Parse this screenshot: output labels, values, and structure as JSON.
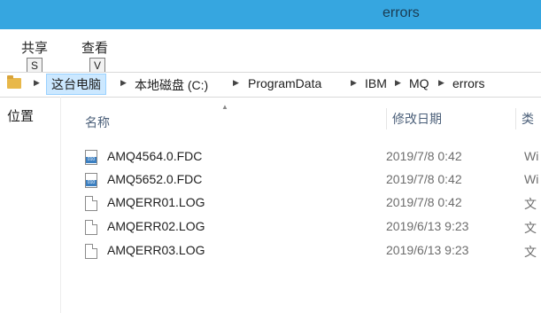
{
  "window": {
    "title": "errors"
  },
  "ribbon": {
    "tabs": [
      {
        "label": "共享",
        "keytip": "S"
      },
      {
        "label": "查看",
        "keytip": "V"
      }
    ]
  },
  "address": {
    "crumbs": [
      "这台电脑",
      "本地磁盘 (C:)",
      "ProgramData",
      "IBM",
      "MQ",
      "errors"
    ]
  },
  "nav": {
    "location_label": "位置"
  },
  "columns": {
    "name": "名称",
    "date": "修改日期",
    "type": "类"
  },
  "files": [
    {
      "name": "AMQ4564.0.FDC",
      "date": "2019/7/8 0:42",
      "type": "Wi",
      "icon": "fdc-file-icon"
    },
    {
      "name": "AMQ5652.0.FDC",
      "date": "2019/7/8 0:42",
      "type": "Wi",
      "icon": "fdc-file-icon"
    },
    {
      "name": "AMQERR01.LOG",
      "date": "2019/7/8 0:42",
      "type": "文",
      "icon": "log-file-icon"
    },
    {
      "name": "AMQERR02.LOG",
      "date": "2019/6/13 9:23",
      "type": "文",
      "icon": "log-file-icon"
    },
    {
      "name": "AMQERR03.LOG",
      "date": "2019/6/13 9:23",
      "type": "文",
      "icon": "log-file-icon"
    }
  ]
}
